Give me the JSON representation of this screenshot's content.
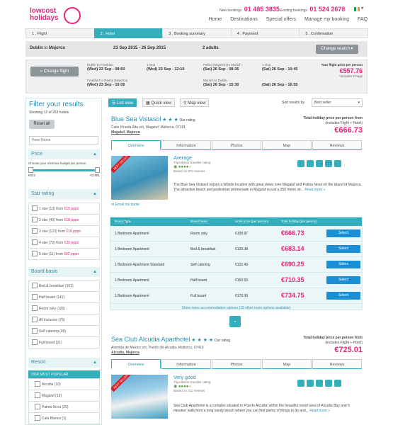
{
  "brand": {
    "line1": "lowcost",
    "line2": "holidays",
    "pink": "#e6237a",
    "teal": "#34aebd"
  },
  "header": {
    "new_bookings_label": "New bookings",
    "new_bookings_phone": "01 485 3835",
    "existing_bookings_label": "Existing bookings",
    "existing_bookings_phone": "01 524 2678",
    "nav": [
      "Home",
      "Destinations",
      "Special offers",
      "Manage my booking",
      "FAQ"
    ]
  },
  "steps": [
    "1 . Flight",
    "2 . Hotel",
    "3 . Booking summary",
    "4 . Payment",
    "5 . Confirmation"
  ],
  "search": {
    "route_from": "Dublin",
    "route_to_word": "to",
    "route_to": "Majorca",
    "dates": "23 Sep 2015 - 26 Sep 2015",
    "adults": "2 adults",
    "change_search": "Change search"
  },
  "flights": {
    "change_flight": "« Change flight",
    "out1_route": "Dublin to Frankfurt",
    "out1_time": "(Wed) 23 Sep - 08:50",
    "out1_stop": "1 stop",
    "out2_route": "Frankfurt to Palma (Majorca)",
    "out2_time": "(Wed) 23 Sep - 10:05",
    "out_arrive": "(Wed) 23 Sep - 12:10",
    "ret1_route": "Palma (Majorca) to Munich",
    "ret1_time": "(Sat) 26 Sep - 08:35",
    "ret1_stop": "1 stop",
    "ret2_route": "Munich to Dublin",
    "ret2_time": "(Sat) 26 Sep - 15:30",
    "ret_arrive1": "(Sat) 26 Sep - 10:45",
    "ret_arrive2": "(Sat) 26 Sep - 16:55",
    "price_label": "Your flight price per person",
    "price": "€557.76",
    "bags": "*includes 2 bags"
  },
  "sidebar": {
    "title": "Filter your results",
    "showing": "Showing 12 of 263 hotels",
    "reset": "Reset all",
    "hotel_name_placeholder": "Hotel Name",
    "price_title": "Price",
    "price_sub": "Choose your min/max budget per person",
    "price_min": "€523",
    "price_max": "€3,861",
    "star_title": "Star rating",
    "stars": [
      {
        "label": "1 star (13) from ",
        "price": "€15 pppn"
      },
      {
        "label": "2 star (40) from ",
        "price": "€18 pppn"
      },
      {
        "label": "3 star (123) from ",
        "price": "€19 pppn"
      },
      {
        "label": "4 star (72) from ",
        "price": "€30 pppn"
      },
      {
        "label": "5 star (11) from ",
        "price": "€82 pppn"
      }
    ],
    "board_title": "Board basis",
    "boards": [
      "Bed & breakfast (161)",
      "Half board (141)",
      "Room only (120)",
      "All inclusive (79)",
      "Self catering (48)",
      "Full board (21)"
    ],
    "resort_title": "Resort",
    "resort_popular": "OUR MOST POPULAR",
    "resorts": [
      "Alcudia (10)",
      "Magaluf (13)",
      "Palma Nova (25)",
      "Cala Blanca (1)"
    ]
  },
  "toolbar": {
    "list_view": "List view",
    "quick_view": "Quick view",
    "map_view": "Map view",
    "sort_label": "Sort results by",
    "sort_value": "Best seller"
  },
  "hotel1": {
    "name": "Blue Sea Vistasol",
    "stars": "★ ★ ★",
    "our_rating": "Our rating",
    "address": "Calle Pineda Alta s/n, Magaluf, Mallorca, 07181",
    "area": "Magaluf, Majorca",
    "total_label": "Total holiday price per person from",
    "total_sub": "(includes Flight + Hotel)",
    "price": "€666.73",
    "tabs": [
      "Overview",
      "Information",
      "Photos",
      "Map",
      "Reviews"
    ],
    "badge": "BEST SELLER",
    "rating_word": "Average",
    "ta_label": "TripAdvisor traveller rating",
    "reviews": "Based on 372 reviews",
    "desc": "The Blue Sea Vistasol enjoys a hillside location with great views over Magaluf and Palma Nova on the island of Majorca. The attractive beach and pedestrian promenade in Magaluf is just a 350 metre str...",
    "read_more": "Read more »",
    "email": "Email my quote"
  },
  "rooms": {
    "headers": [
      "Room Type",
      "Board basis",
      "Hotel price (per person)",
      "Total holiday (per person)"
    ],
    "rows": [
      {
        "type": "1 Bedroom Apartment",
        "board": "Room only",
        "hotel": "€108.97",
        "total": "€666.73"
      },
      {
        "type": "1 Bedroom Apartment",
        "board": "Bed & breakfast",
        "hotel": "€125.38",
        "total": "€683.14"
      },
      {
        "type": "1 Bedroom Apartment Standard",
        "board": "Self catering",
        "hotel": "€132.49",
        "total": "€690.25"
      },
      {
        "type": "1 Bedroom Apartment",
        "board": "Half board",
        "hotel": "€152.59",
        "total": "€710.35"
      },
      {
        "type": "1 Bedroom Apartment",
        "board": "Full board",
        "hotel": "€176.99",
        "total": "€734.75"
      }
    ],
    "select": "Select",
    "more": "Show more accommodation options (19 other room options available)"
  },
  "hotel2": {
    "name": "Sea Club Alcudia Aparthotel",
    "stars": "★ ★ ★ ★",
    "our_rating": "Our rating",
    "address": "Avenida de Mexico s/n, Puerto de Alcudia, Mallorca, 07410",
    "area": "Alcudia, Majorca",
    "total_label": "Total holiday price per person from",
    "total_sub": "(includes Flight + Hotel)",
    "price": "€725.01",
    "tabs": [
      "Overview",
      "Information",
      "Photos",
      "Map",
      "Reviews"
    ],
    "badge": "BEST SELLER",
    "rating_word": "Very good",
    "ta_label": "TripAdvisor traveller rating",
    "reviews": "Based on 311 reviews",
    "desc": "Sea Club Aparthotel is a complex situated in 'Puerto Alcudia' within the beautiful resort area of Alcudia Bay and 5 minutes' walk from a long sandy beach where you can find plenty of things to do and...",
    "read_more": "Read more »"
  }
}
